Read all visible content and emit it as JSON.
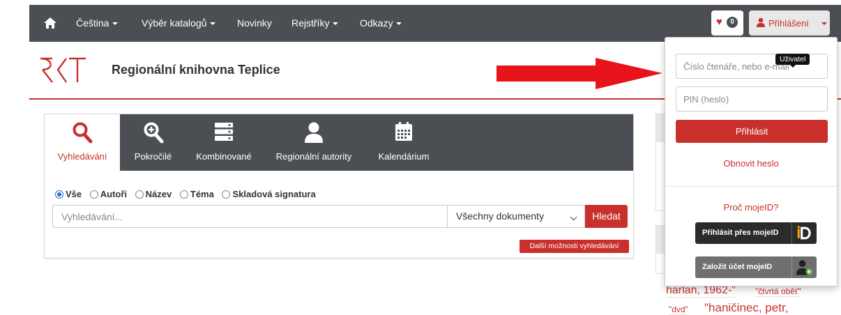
{
  "colors": {
    "accent": "#c9302c",
    "navbar": "#4b4f54",
    "radio_checked": "#1e6fd9"
  },
  "navbar": {
    "home_icon": "home-icon",
    "items": [
      {
        "label": "Čeština",
        "dropdown": true
      },
      {
        "label": "Výběr katalogů",
        "dropdown": true
      },
      {
        "label": "Novinky",
        "dropdown": false
      },
      {
        "label": "Rejstříky",
        "dropdown": true
      },
      {
        "label": "Odkazy",
        "dropdown": true
      }
    ],
    "favorites": {
      "icon": "heart-icon",
      "count": "0"
    },
    "login": {
      "icon": "user-icon",
      "label": "Přihlášení"
    }
  },
  "header": {
    "logo": "rkt-logo",
    "library_name": "Regionální knihovna Teplice"
  },
  "search": {
    "tabs": [
      {
        "label": "Vyhledávání",
        "icon": "search-icon",
        "active": true
      },
      {
        "label": "Pokročilé",
        "icon": "zoom-in-icon",
        "active": false
      },
      {
        "label": "Kombinované",
        "icon": "stack-icon",
        "active": false
      },
      {
        "label": "Regionální autority",
        "icon": "person-icon",
        "active": false
      },
      {
        "label": "Kalendárium",
        "icon": "calendar-icon",
        "active": false
      }
    ],
    "filters": [
      {
        "label": "Vše",
        "checked": true
      },
      {
        "label": "Autoři",
        "checked": false
      },
      {
        "label": "Název",
        "checked": false
      },
      {
        "label": "Téma",
        "checked": false
      },
      {
        "label": "Skladová signatura",
        "checked": false
      }
    ],
    "input_placeholder": "Vyhledávání...",
    "doc_type_selected": "Všechny dokumenty",
    "submit_label": "Hledat",
    "more_options_label": "Další možnosti vyhledávání"
  },
  "login_dropdown": {
    "username_placeholder": "Číslo čtenáře, nebo e-mail",
    "tooltip": "Uživatel",
    "pin_placeholder": "PIN (heslo)",
    "submit_label": "Přihlásit",
    "reset_link": "Obnovit heslo",
    "why_mojeid": "Proč mojeID?",
    "mojeid_login": "Přihlásit přes mojeID",
    "mojeid_create": "Založit účet mojeID"
  },
  "tag_cloud": {
    "tags": [
      {
        "text": "harlan, 1962-\""
      },
      {
        "text": "\"čtvrtá oběť\""
      },
      {
        "text": "\"dvd\""
      },
      {
        "text": "\"haničinec, petr,"
      }
    ]
  }
}
